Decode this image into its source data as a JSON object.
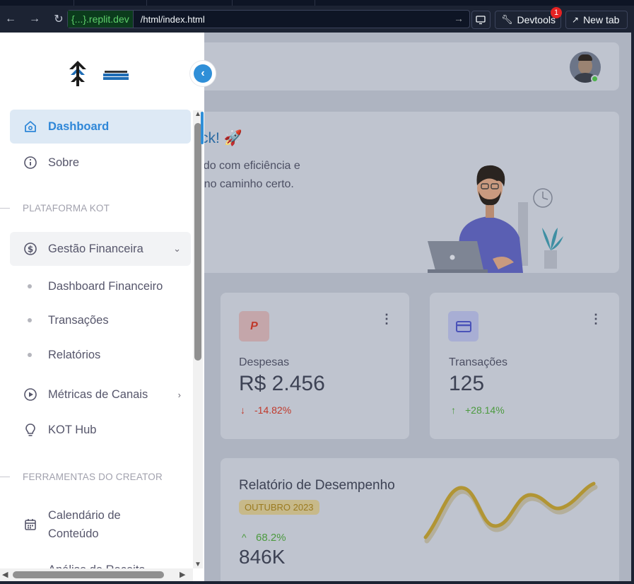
{
  "browser": {
    "url_host_prefix": "{...}",
    "url_host": ".replit.dev",
    "url_path": "/html/index.html",
    "devtools_label": "Devtools",
    "devtools_badge": "1",
    "newtab_label": "New tab"
  },
  "sidebar": {
    "items": [
      {
        "label": "Dashboard",
        "icon": "home-icon"
      },
      {
        "label": "Sobre",
        "icon": "info-icon"
      }
    ],
    "section1": "PLATAFORMA KOT",
    "finance": {
      "label": "Gestão Financeira",
      "icon": "dollar-icon",
      "children": [
        "Dashboard Financeiro",
        "Transações",
        "Relatórios"
      ]
    },
    "metrics": {
      "label": "Métricas de Canais",
      "icon": "play-circle-icon"
    },
    "hub": {
      "label": "KOT Hub",
      "icon": "bulb-icon"
    },
    "section2": "FERRAMENTAS DO CREATOR",
    "calendar": {
      "label_line1": "Calendário de",
      "label_line2": "Conteúdo",
      "icon": "calendar-icon"
    },
    "cut_item": "Análise de Receita"
  },
  "main": {
    "welcome_title": "ck! 🚀",
    "welcome_line1": "eúdo com eficiência e",
    "welcome_line2": "or no caminho certo.",
    "expenses": {
      "title": "Despesas",
      "value": "R$ 2.456",
      "change": "-14.82%"
    },
    "transactions": {
      "title": "Transações",
      "value": "125",
      "change": "+28.14%"
    },
    "report": {
      "title": "Relatório de Desempenho",
      "badge": "OUTUBRO 2023",
      "change": "68.2%",
      "value": "846K"
    }
  },
  "colors": {
    "accent": "#2f8fd8",
    "negative": "#c0392b",
    "positive": "#4c9a3f",
    "warning": "#c9a646"
  }
}
